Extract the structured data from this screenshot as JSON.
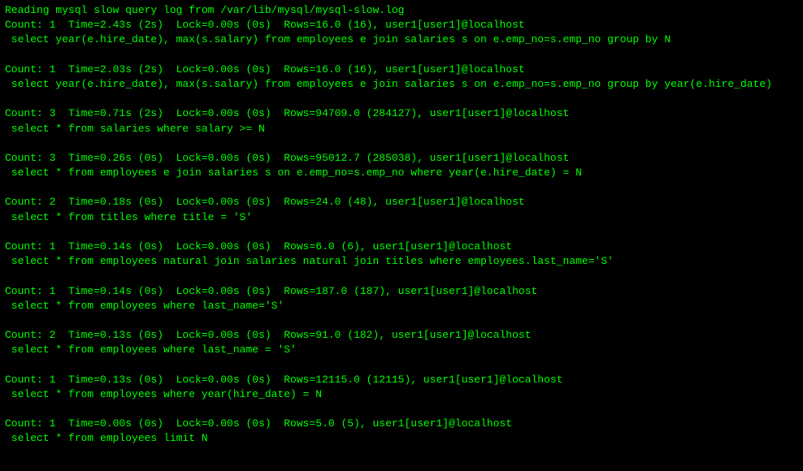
{
  "header": "Reading mysql slow query log from /var/lib/mysql/mysql-slow.log",
  "entries": [
    {
      "stats": "Count: 1  Time=2.43s (2s)  Lock=0.00s (0s)  Rows=16.0 (16), user1[user1]@localhost",
      "query": " select year(e.hire_date), max(s.salary) from employees e join salaries s on e.emp_no=s.emp_no group by N"
    },
    {
      "stats": "Count: 1  Time=2.03s (2s)  Lock=0.00s (0s)  Rows=16.0 (16), user1[user1]@localhost",
      "query": " select year(e.hire_date), max(s.salary) from employees e join salaries s on e.emp_no=s.emp_no group by year(e.hire_date)"
    },
    {
      "stats": "Count: 3  Time=0.71s (2s)  Lock=0.00s (0s)  Rows=94709.0 (284127), user1[user1]@localhost",
      "query": " select * from salaries where salary >= N"
    },
    {
      "stats": "Count: 3  Time=0.26s (0s)  Lock=0.00s (0s)  Rows=95012.7 (285038), user1[user1]@localhost",
      "query": " select * from employees e join salaries s on e.emp_no=s.emp_no where year(e.hire_date) = N"
    },
    {
      "stats": "Count: 2  Time=0.18s (0s)  Lock=0.00s (0s)  Rows=24.0 (48), user1[user1]@localhost",
      "query": " select * from titles where title = 'S'"
    },
    {
      "stats": "Count: 1  Time=0.14s (0s)  Lock=0.00s (0s)  Rows=6.0 (6), user1[user1]@localhost",
      "query": " select * from employees natural join salaries natural join titles where employees.last_name='S'"
    },
    {
      "stats": "Count: 1  Time=0.14s (0s)  Lock=0.00s (0s)  Rows=187.0 (187), user1[user1]@localhost",
      "query": " select * from employees where last_name='S'"
    },
    {
      "stats": "Count: 2  Time=0.13s (0s)  Lock=0.00s (0s)  Rows=91.0 (182), user1[user1]@localhost",
      "query": " select * from employees where last_name = 'S'"
    },
    {
      "stats": "Count: 1  Time=0.13s (0s)  Lock=0.00s (0s)  Rows=12115.0 (12115), user1[user1]@localhost",
      "query": " select * from employees where year(hire_date) = N"
    },
    {
      "stats": "Count: 1  Time=0.00s (0s)  Lock=0.00s (0s)  Rows=5.0 (5), user1[user1]@localhost",
      "query": " select * from employees limit N"
    }
  ]
}
